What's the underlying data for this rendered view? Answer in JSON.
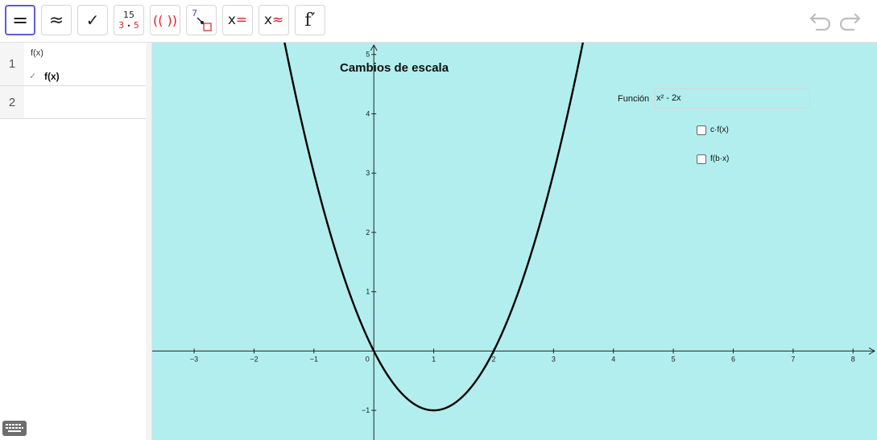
{
  "toolbar": {
    "buttons": [
      {
        "name": "exact-button",
        "symbol": "="
      },
      {
        "name": "approx-button",
        "symbol": "≈"
      },
      {
        "name": "check-button",
        "symbol": "✓"
      },
      {
        "name": "factor-button",
        "top": "15",
        "bottom_left": "3",
        "bottom_mid": "•",
        "bottom_right": "5"
      },
      {
        "name": "expand-button",
        "symbol": "(( ))"
      },
      {
        "name": "substitute-button",
        "number": "7"
      },
      {
        "name": "solve-button",
        "x": "x",
        "op": "="
      },
      {
        "name": "nsolve-button",
        "x": "x",
        "op": "≈"
      },
      {
        "name": "derivative-button",
        "symbol": "f′"
      }
    ]
  },
  "algebra": {
    "rows": [
      {
        "number": "1",
        "input": "f(x)",
        "output": "f(x)",
        "check": "✓"
      },
      {
        "number": "2",
        "input": "",
        "output": ""
      }
    ]
  },
  "graphics": {
    "title": "Cambios de escala",
    "function_label": "Función",
    "function_value": "x² - 2x",
    "checkboxes": [
      {
        "label": "c·f(x)",
        "checked": false
      },
      {
        "label": "f(b·x)",
        "checked": false
      }
    ],
    "x_ticks": [
      "−3",
      "−2",
      "−1",
      "0",
      "1",
      "2",
      "3",
      "4",
      "5",
      "6",
      "7",
      "8"
    ],
    "x_tick_values": [
      -3,
      -2,
      -1,
      0,
      1,
      2,
      3,
      4,
      5,
      6,
      7,
      8
    ],
    "y_ticks": [
      "−1",
      "1",
      "2",
      "3",
      "4",
      "5"
    ],
    "y_tick_values": [
      -1,
      1,
      2,
      3,
      4,
      5
    ],
    "x_range": [
      -3.7,
      8.4
    ],
    "y_range": [
      -1.5,
      5.2
    ],
    "background": "#b2eeee",
    "curve": "x^2 - 2x"
  }
}
